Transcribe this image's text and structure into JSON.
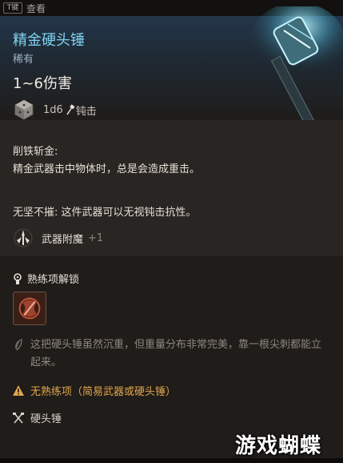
{
  "topbar": {
    "key": "T键",
    "view": "查看"
  },
  "item": {
    "name": "精金硬头锤",
    "rarity": "稀有",
    "damage": "1~6伤害",
    "dice": "1d6",
    "damage_type": "钝击"
  },
  "passive": {
    "title": "削铁斩金:",
    "description": "精金武器击中物体时，总是会造成重击。",
    "second": "无坚不摧: 这件武器可以无视钝击抗性。"
  },
  "enchant": {
    "label": "武器附魔",
    "bonus": "+1"
  },
  "proficiency": {
    "unlock_label": "熟练项解锁"
  },
  "flavor": "这把硬头锤虽然沉重，但重量分布非常完美，靠一根尖刺都能立起来。",
  "warning": "无熟练项（简易武器或硬头锤）",
  "weapon_type": "硬头锤",
  "watermark": "游戏蝴蝶",
  "colors": {
    "name": "#7fd3f0",
    "warning": "#e3a64a",
    "flavor": "#8d877e"
  }
}
